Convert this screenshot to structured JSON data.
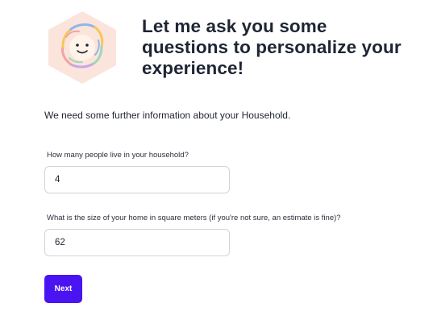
{
  "assistant": {
    "avatar_icon": "smiling-face-hexagon-icon",
    "avatar_bg": "#fbe4dc"
  },
  "header": {
    "title": "Let me ask you some questions to personalize your experience!"
  },
  "intro": "We need some further information about your Household.",
  "form": {
    "people_label": "How many people live in your household?",
    "people_value": "4",
    "size_label": "What is the size of your home in square meters (if you're not sure, an estimate is fine)?",
    "size_value": "62",
    "next_label": "Next"
  },
  "colors": {
    "accent": "#4a14f2",
    "text": "#1e2533",
    "border": "#cfd3da"
  }
}
